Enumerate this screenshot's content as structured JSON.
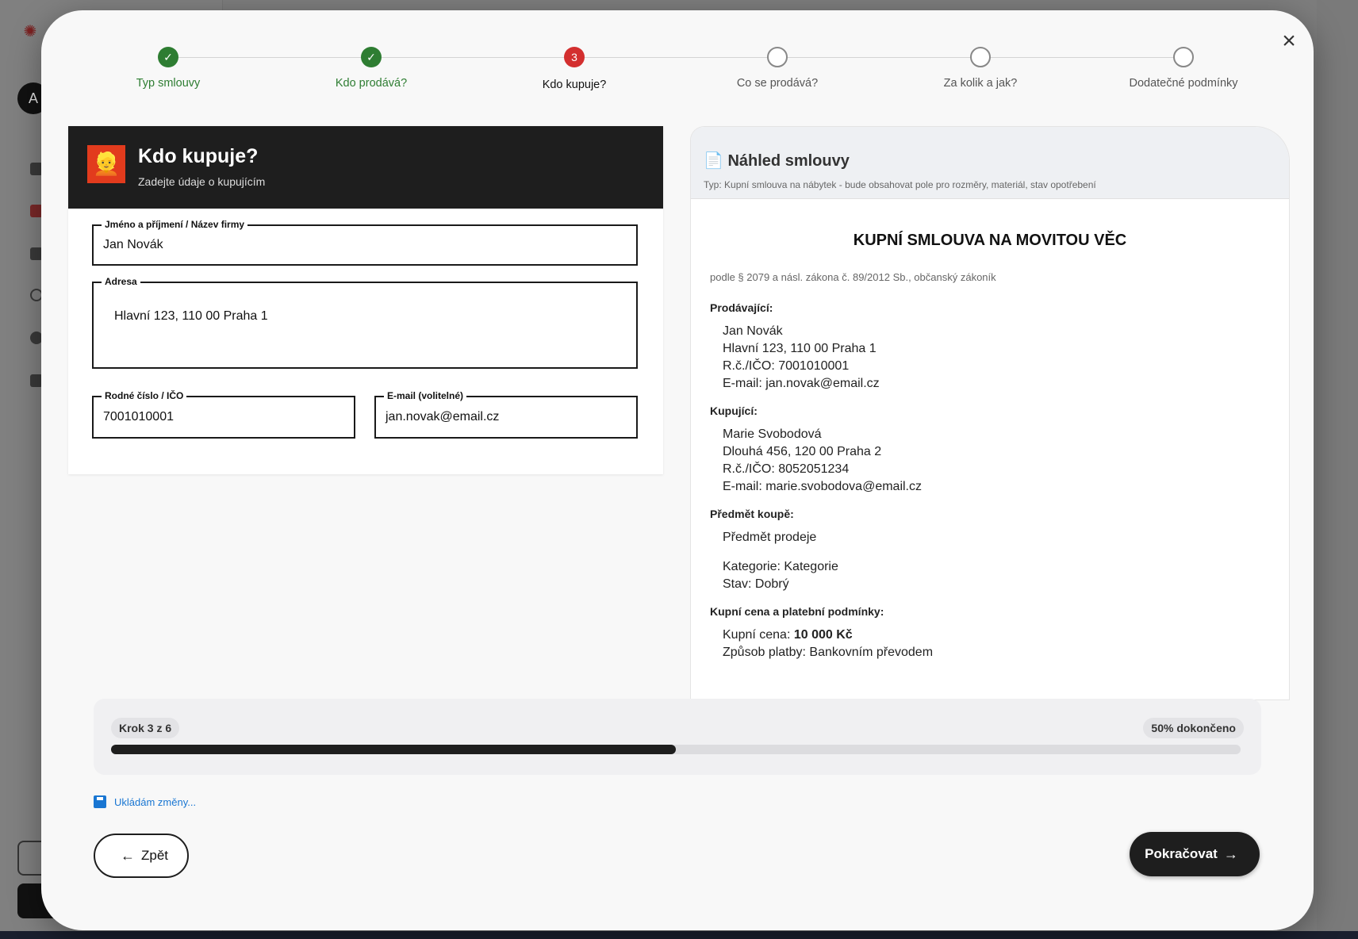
{
  "background": {
    "avatar_initial": "A"
  },
  "stepper": {
    "steps": [
      {
        "label": "Typ smlouvy",
        "state": "done"
      },
      {
        "label": "Kdo prodává?",
        "state": "done"
      },
      {
        "label": "Kdo kupuje?",
        "state": "active",
        "number": "3"
      },
      {
        "label": "Co se prodává?",
        "state": "pending"
      },
      {
        "label": "Za kolik a jak?",
        "state": "pending"
      },
      {
        "label": "Dodatečné podmínky",
        "state": "pending"
      }
    ]
  },
  "form": {
    "emoji": "👱",
    "title": "Kdo kupuje?",
    "subtitle": "Zadejte údaje o kupujícím",
    "fields": {
      "name": {
        "label": "Jméno a příjmení / Název firmy",
        "value": "Jan Novák"
      },
      "address": {
        "label": "Adresa",
        "value": "Hlavní 123, 110 00 Praha 1"
      },
      "id": {
        "label": "Rodné číslo / IČO",
        "value": "7001010001"
      },
      "email": {
        "label": "E-mail (volitelné)",
        "value": "jan.novak@email.cz"
      }
    }
  },
  "preview": {
    "title": "📄 Náhled smlouvy",
    "type_note": "Typ: Kupní smlouva na nábytek - bude obsahovat pole pro rozměry, materiál, stav opotřebení",
    "doc_title": "KUPNÍ SMLOUVA NA MOVITOU VĚC",
    "law": "podle § 2079 a násl. zákona č. 89/2012 Sb., občanský zákoník",
    "seller_heading": "Prodávající:",
    "seller": [
      "Jan Novák",
      "Hlavní 123, 110 00 Praha 1",
      "R.č./IČO: 7001010001",
      "E-mail: jan.novak@email.cz"
    ],
    "buyer_heading": "Kupující:",
    "buyer": [
      "Marie Svobodová",
      "Dlouhá 456, 120 00 Praha 2",
      "R.č./IČO: 8052051234",
      "E-mail: marie.svobodova@email.cz"
    ],
    "subject_heading": "Předmět koupě:",
    "subject": [
      "Předmět prodeje",
      "Kategorie: Kategorie",
      "Stav: Dobrý"
    ],
    "price_heading": "Kupní cena a platební podmínky:",
    "price_label": "Kupní cena: ",
    "price_value": "10 000 Kč",
    "payment": "Způsob platby: Bankovním převodem"
  },
  "progress": {
    "step_text": "Krok 3 z 6",
    "percent_text": "50% dokončeno",
    "fraction": 0.5
  },
  "saving_text": "Ukládám změny...",
  "buttons": {
    "back": "Zpět",
    "next": "Pokračovat"
  },
  "icons": {
    "close": "close-icon",
    "back": "arrow-left-icon",
    "next": "arrow-right-icon",
    "save": "save-icon"
  }
}
